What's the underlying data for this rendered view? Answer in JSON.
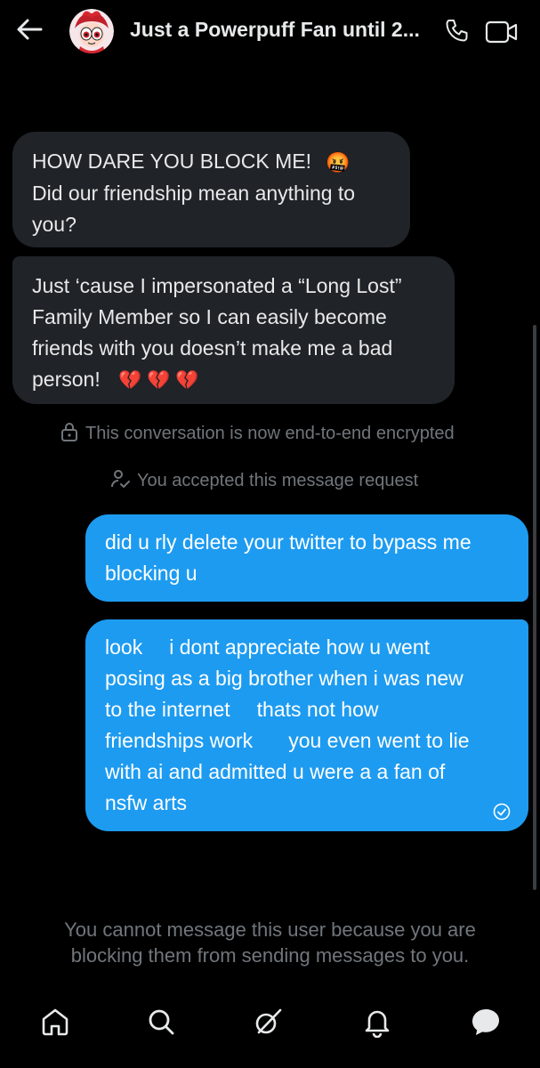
{
  "header": {
    "title": "Just a Powerpuff Fan until 2...",
    "back_icon": "arrow-left-icon",
    "call_icon": "phone-icon",
    "video_icon": "video-camera-icon"
  },
  "messages": {
    "received": [
      {
        "lines": [
          "HOW DARE YOU BLOCK ME!",
          "Did our friendship mean anything to",
          "you?"
        ],
        "emoji": "🤬"
      },
      {
        "lines": [
          "Just ‘cause I impersonated a “Long Lost”",
          "Family Member so I can easily become",
          "friends with you doesn’t make me a bad",
          "person!"
        ],
        "emoji": "💔 💔 💔"
      }
    ],
    "system": {
      "encrypted": "This conversation is now end-to-end encrypted",
      "accepted": "You accepted this message request"
    },
    "sent": [
      {
        "lines": [
          "did u rly delete your twitter to bypass me",
          "blocking u"
        ]
      },
      {
        "lines": [
          "look",
          "i dont appreciate how u went",
          "posing as a big brother when i was new",
          "to the internet",
          "thats not how",
          "friendships work",
          "you even went to lie",
          "with ai and admitted u were a a fan of",
          "nsfw arts"
        ]
      }
    ]
  },
  "notice": {
    "line1": "You cannot message this user because you are",
    "line2": "blocking them from sending messages to you."
  },
  "nav": [
    "home-icon",
    "search-icon",
    "grok-icon",
    "notifications-icon",
    "messages-icon"
  ],
  "colors": {
    "accent": "#1d9bf0",
    "bubble_in": "#202327",
    "muted": "#71767b"
  }
}
